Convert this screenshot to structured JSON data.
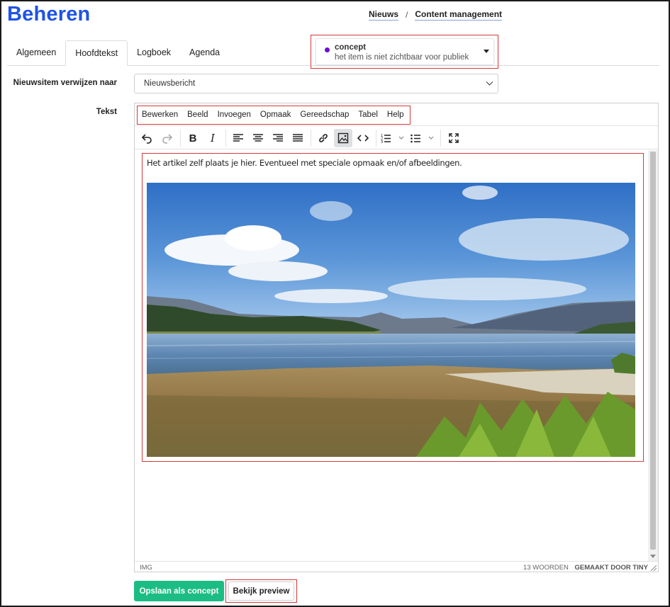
{
  "app": {
    "title": "Beheren"
  },
  "breadcrumb": {
    "items": [
      "Nieuws",
      "Content management"
    ],
    "separator": "/"
  },
  "tabs": [
    "Algemeen",
    "Hoofdtekst",
    "Logboek",
    "Agenda"
  ],
  "active_tab": "Hoofdtekst",
  "status": {
    "title": "concept",
    "subtitle": "het item is niet zichtbaar voor publiek",
    "dot_color": "#6a0fcf"
  },
  "form": {
    "redirect_label": "Nieuwsitem verwijzen naar",
    "redirect_value": "Nieuwsbericht",
    "text_label": "Tekst"
  },
  "editor": {
    "menu": [
      "Bewerken",
      "Beeld",
      "Invoegen",
      "Opmaak",
      "Gereedschap",
      "Tabel",
      "Help"
    ],
    "toolbar_icons": [
      "undo-icon",
      "redo-icon",
      "bold-icon",
      "italic-icon",
      "align-left-icon",
      "align-center-icon",
      "align-right-icon",
      "align-justify-icon",
      "link-icon",
      "image-icon",
      "code-icon",
      "numbered-list-icon",
      "bullet-list-icon",
      "fullscreen-icon"
    ],
    "body_text": "Het artikel zelf plaats je hier. Eventueel met speciale opmaak en/of afbeeldingen.",
    "status_path": "IMG",
    "word_count": "13 WOORDEN",
    "branding": "GEMAAKT DOOR TINY"
  },
  "actions": {
    "save_label": "Opslaan als concept",
    "preview_label": "Bekijk preview"
  },
  "colors": {
    "accent": "#1e53e5",
    "save_button": "#1cbd84",
    "highlight": "#d43a3a"
  }
}
